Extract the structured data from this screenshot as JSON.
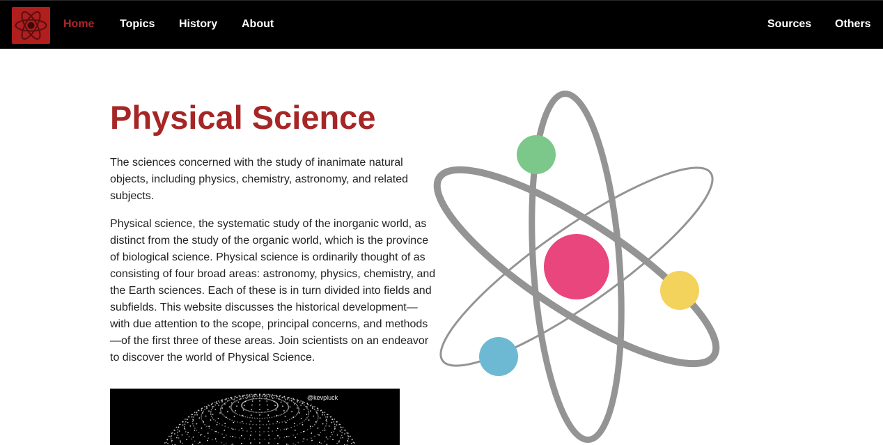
{
  "nav": {
    "logo_icon": "atom-logo-icon",
    "left_links": [
      "Home",
      "Topics",
      "History",
      "About"
    ],
    "right_links": [
      "Sources",
      "Others"
    ],
    "active": "Home"
  },
  "hero": {
    "title": "Physical Science",
    "intro": "The sciences concerned with the study of inanimate natural objects, including physics, chemistry, astronomy, and related subjects.",
    "body": "Physical science, the systematic study of the inorganic world, as distinct from the study of the organic world, which is the province of biological science. Physical science is ordinarily thought of as consisting of four broad areas: astronomy, physics, chemistry, and the Earth sciences. Each of these is in turn divided into fields and subfields. This website discusses the historical development—with due attention to the scope, principal concerns, and methods—of the first three of these areas. Join scientists on an endeavor to discover the world of Physical Science."
  },
  "video": {
    "handle": "@kevpluck"
  },
  "illustration": {
    "icon": "atom-illustration",
    "colors": {
      "orbit": "#949494",
      "nucleus": "#e9467d",
      "electron_green": "#7cc88a",
      "electron_yellow": "#f4d35c",
      "electron_blue": "#6db9d3"
    }
  },
  "colors": {
    "brand_red": "#a62626",
    "nav_bg": "#000000",
    "logo_bg": "#b01e1e"
  }
}
